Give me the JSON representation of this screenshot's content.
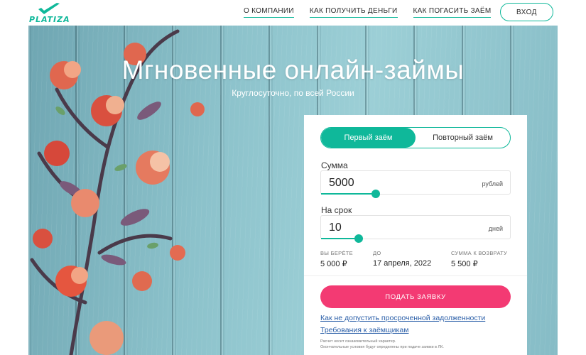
{
  "header": {
    "logo_text": "PLATIZA",
    "nav": [
      {
        "label": "О КОМПАНИИ"
      },
      {
        "label": "КАК ПОЛУЧИТЬ ДЕНЬГИ"
      },
      {
        "label": "КАК ПОГАСИТЬ ЗАЁМ"
      }
    ],
    "login_label": "ВХОД"
  },
  "hero": {
    "title": "Мгновенные онлайн-займы",
    "subtitle": "Круглосуточно, по всей России"
  },
  "form": {
    "tabs": [
      {
        "label": "Первый заём",
        "active": true
      },
      {
        "label": "Повторный заём",
        "active": false
      }
    ],
    "amount": {
      "label": "Сумма",
      "value": "5000",
      "unit": "рублей",
      "slider_fraction": 0.29
    },
    "term": {
      "label": "На срок",
      "value": "10",
      "unit": "дней",
      "slider_fraction": 0.2
    },
    "summary": [
      {
        "heading": "ВЫ БЕРЁТЕ",
        "value": "5 000 ₽"
      },
      {
        "heading": "ДО",
        "value": "17 апреля, 2022"
      },
      {
        "heading": "СУММА К ВОЗВРАТУ",
        "value": "5 500 ₽"
      }
    ],
    "submit_label": "ПОДАТЬ ЗАЯВКУ",
    "links": [
      {
        "label": "Как не допустить просроченной задолженности"
      },
      {
        "label": "Требования к заёмщикам"
      }
    ],
    "notes": [
      "Расчет носит ознакомительный характер.",
      "Окончательные условия будут определены при подаче заявки в ЛК."
    ]
  },
  "colors": {
    "accent": "#0fb89a",
    "submit": "#f33a73",
    "link": "#2b5fa8"
  }
}
